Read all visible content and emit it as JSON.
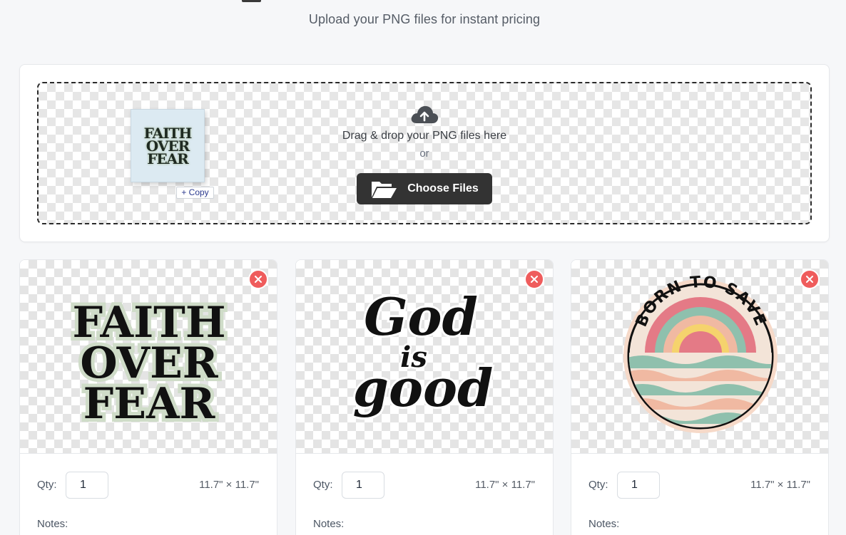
{
  "header": {
    "subtitle": "Upload your PNG files for instant pricing"
  },
  "upload": {
    "drag_text": "Drag & drop your PNG files here",
    "or_text": "or",
    "choose_label": "Choose Files",
    "copy_badge": "+ Copy",
    "ghost_art_lines": [
      "FAITH",
      "OVER",
      "FEAR"
    ]
  },
  "products": [
    {
      "art_text": [
        "FAITH",
        "OVER",
        "FEAR"
      ],
      "qty_label": "Qty:",
      "qty_value": "1",
      "size": "11.7\" × 11.7\"",
      "notes_label": "Notes:"
    },
    {
      "art_text": [
        "God",
        "is",
        "good"
      ],
      "qty_label": "Qty:",
      "qty_value": "1",
      "size": "11.7\" × 11.7\"",
      "notes_label": "Notes:"
    },
    {
      "art_text": [
        "BORN TO SAVE"
      ],
      "qty_label": "Qty:",
      "qty_value": "1",
      "size": "11.7\" × 11.7\"",
      "notes_label": "Notes:"
    }
  ],
  "colors": {
    "accent_dark": "#333333",
    "remove_red": "#ef5c5c",
    "page_bg": "#f6f7f9"
  },
  "icons": [
    "cloud-upload-icon",
    "folder-open-icon",
    "close-icon"
  ]
}
